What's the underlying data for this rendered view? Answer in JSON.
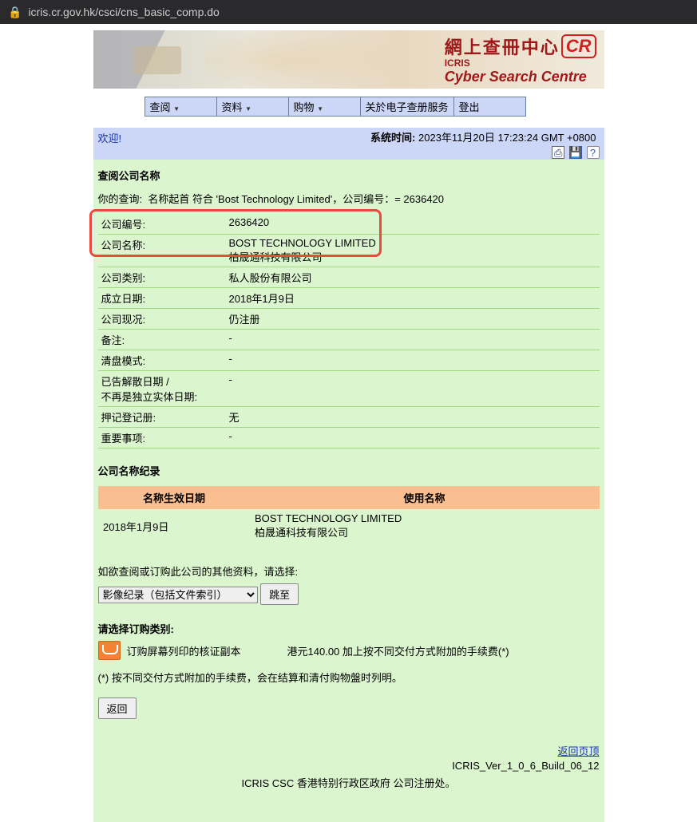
{
  "url": "icris.cr.gov.hk/csci/cns_basic_comp.do",
  "banner": {
    "cn": "網上查冊中心",
    "cr": "CR",
    "en1": "ICRIS",
    "en2": "Cyber Search Centre"
  },
  "menu": {
    "browse": "查阅",
    "info": "资料",
    "cart": "购物",
    "eservice": "关於电子查册服务",
    "logout": "登出"
  },
  "welcome": "欢迎!",
  "systime_label": "系统时间:",
  "systime_value": "2023年11月20日 17:23:24 GMT +0800",
  "section_title": "查阅公司名称",
  "query_prefix": "你的查询:  名称起首 符合 'Bost Technology Limited'，公司编号：= 2636420",
  "details": {
    "cr_no_label": "公司编号:",
    "cr_no": "2636420",
    "name_label": "公司名称:",
    "name_en": "BOST TECHNOLOGY LIMITED",
    "name_cn": "柏晟通科技有限公司",
    "type_label": "公司类别:",
    "type": "私人股份有限公司",
    "inc_label": "成立日期:",
    "inc": "2018年1月9日",
    "status_label": "公司现况:",
    "status": "仍注册",
    "remark_label": "备注:",
    "remark": "-",
    "wind_label": "清盘模式:",
    "wind": "-",
    "dissolve_label1": "已告解散日期 /",
    "dissolve_label2": "不再是独立实体日期:",
    "dissolve": "-",
    "charge_label": "押记登记册:",
    "charge": "无",
    "important_label": "重要事项:",
    "important": "-"
  },
  "name_history": {
    "heading": "公司名称纪录",
    "col1": "名称生效日期",
    "col2": "使用名称",
    "rows": [
      {
        "date": "2018年1月9日",
        "name_en": "BOST TECHNOLOGY LIMITED",
        "name_cn": "柏晟通科技有限公司"
      }
    ]
  },
  "prompt_other": "如欲查阅或订购此公司的其他资料，请选择:",
  "select_option": "影像纪录（包括文件索引）",
  "goto_btn": "跳至",
  "order_heading": "请选择订购类别:",
  "cart_label": "订购屏幕列印的核证副本",
  "cart_fee": "港元140.00 加上按不同交付方式附加的手续费(*)",
  "fee_note": "(*) 按不同交付方式附加的手续费，会在结算和清付购物盤时列明。",
  "back_btn": "返回",
  "top_link": "返回页顶",
  "version": "ICRIS_Ver_1_0_6_Build_06_12",
  "footer": "ICRIS CSC 香港特别行政区政府 公司注册处。"
}
